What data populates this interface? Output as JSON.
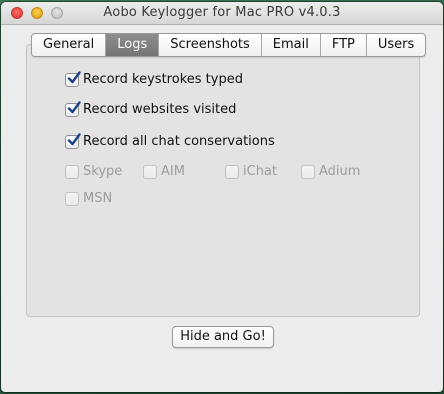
{
  "window": {
    "title": "Aobo Keylogger for Mac PRO v4.0.3"
  },
  "tabs": [
    {
      "label": "General",
      "active": false
    },
    {
      "label": "Logs",
      "active": true
    },
    {
      "label": "Screenshots",
      "active": false
    },
    {
      "label": "Email",
      "active": false
    },
    {
      "label": "FTP",
      "active": false
    },
    {
      "label": "Users",
      "active": false
    }
  ],
  "logs": {
    "record_keystrokes": {
      "label": "Record keystrokes typed",
      "checked": true
    },
    "record_websites": {
      "label": "Record websites visited",
      "checked": true
    },
    "record_chats": {
      "label": "Record all chat conservations",
      "checked": true
    },
    "chat_apps": [
      {
        "label": "Skype",
        "checked": false,
        "enabled": false
      },
      {
        "label": "AIM",
        "checked": false,
        "enabled": false
      },
      {
        "label": "iChat",
        "checked": false,
        "enabled": false
      },
      {
        "label": "Adium",
        "checked": false,
        "enabled": false
      },
      {
        "label": "MSN",
        "checked": false,
        "enabled": false
      }
    ]
  },
  "actions": {
    "hide_and_go_label": "Hide and Go!"
  },
  "colors": {
    "checkbox_check": "#1c3f8c",
    "active_tab": "#7f7f7f"
  }
}
